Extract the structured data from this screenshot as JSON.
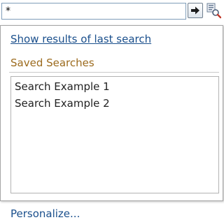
{
  "search": {
    "value": "*"
  },
  "popup": {
    "last_search_link": "Show results of last search",
    "saved_searches_heading": "Saved Searches",
    "saved_searches": [
      {
        "label": "Search Example 1"
      },
      {
        "label": "Search Example 2"
      }
    ],
    "personalize_link": "Personalize..."
  },
  "icons": {
    "go": "arrow-right-icon",
    "advanced": "advanced-search-icon"
  },
  "colors": {
    "link": "#1a4f8c",
    "section_heading": "#9c6b1e",
    "input_border": "#7f9db9"
  }
}
